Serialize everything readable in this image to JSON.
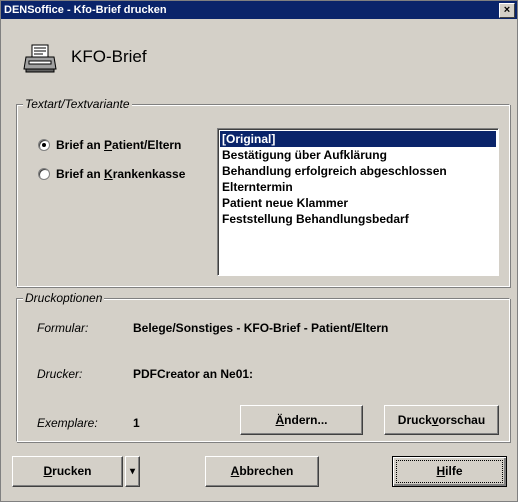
{
  "window": {
    "title": "DENSoffice - Kfo-Brief drucken",
    "close_glyph": "×"
  },
  "header": {
    "icon": "printer-icon",
    "title": "KFO-Brief"
  },
  "textart": {
    "legend": "Textart/Textvariante",
    "radio_patient": {
      "pre": "Brief an ",
      "u": "P",
      "post": "atient/Eltern",
      "checked": true
    },
    "radio_kasse": {
      "pre": "Brief an ",
      "u": "K",
      "post": "rankenkasse",
      "checked": false
    },
    "variants": [
      "[Original]",
      "Bestätigung über Aufklärung",
      "Behandlung erfolgreich abgeschlossen",
      "Elterntermin",
      "Patient neue Klammer",
      "Feststellung Behandlungsbedarf"
    ],
    "selected_index": 0
  },
  "druck": {
    "legend": "Druckoptionen",
    "formular_label": "Formular:",
    "formular_value": "Belege/Sonstiges - KFO-Brief - Patient/Eltern",
    "drucker_label": "Drucker:",
    "drucker_value": "PDFCreator an Ne01:",
    "exemplare_label": "Exemplare:",
    "exemplare_value": "1",
    "aendern": {
      "u": "Ä",
      "post": "ndern..."
    },
    "vorschau": {
      "pre": "Druck",
      "u": "v",
      "post": "orschau"
    }
  },
  "footer": {
    "drucken": {
      "u": "D",
      "post": "rucken"
    },
    "dropdown_glyph": "▾",
    "abbrechen": {
      "u": "A",
      "post": "bbrechen"
    },
    "hilfe": {
      "u": "H",
      "post": "ilfe"
    }
  },
  "colors": {
    "titlebar": "#0a246a",
    "face": "#d4d0c8",
    "selection": "#0a246a"
  }
}
